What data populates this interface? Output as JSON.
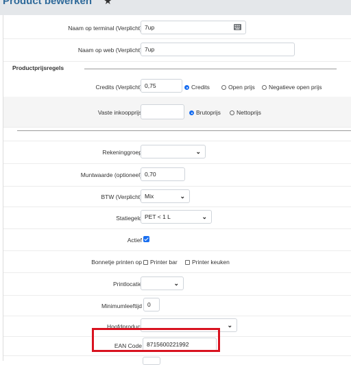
{
  "header": {
    "title": "Product bewerken",
    "star_icon": "star-icon"
  },
  "terminal": {
    "label": "Naam op terminal (Verplicht)",
    "value": "7up",
    "icon": "keyboard-icon"
  },
  "web": {
    "label": "Naam op web (Verplicht)",
    "value": "7up"
  },
  "price_rules": {
    "section_title": "Productprijsregels"
  },
  "credits": {
    "label": "Credits (Verplicht)",
    "value": "0,75",
    "options": [
      "Credits",
      "Open prijs",
      "Negatieve open prijs"
    ],
    "selected": "Credits"
  },
  "purchase": {
    "label": "Vaste inkoopprijs",
    "value": "",
    "options": [
      "Brutoprijs",
      "Nettoprijs"
    ],
    "selected": "Brutoprijs"
  },
  "account_group": {
    "label": "Rekeninggroep",
    "value": ""
  },
  "coin_value": {
    "label": "Muntwaarde (optioneel)",
    "value": "0,70"
  },
  "vat": {
    "label": "BTW (Verplicht)",
    "value": "Mix"
  },
  "deposit": {
    "label": "Statiegeld",
    "value": "PET < 1 L"
  },
  "active": {
    "label": "Actief",
    "checked": true
  },
  "receipt": {
    "label": "Bonnetje printen op",
    "options": [
      "Printer bar",
      "Printer keuken"
    ]
  },
  "print_location": {
    "label": "Printlocatie",
    "value": ""
  },
  "min_age": {
    "label": "Minimumleeftijd",
    "value": "0"
  },
  "main_product": {
    "label": "Hoofdproduct",
    "value": ""
  },
  "ean": {
    "label": "EAN Code",
    "value": "8715600221992"
  },
  "colors": {
    "accent": "#1a6ff0",
    "title": "#2f6a9a",
    "highlight": "#d9121f",
    "header_bg": "#e4e7ea"
  }
}
